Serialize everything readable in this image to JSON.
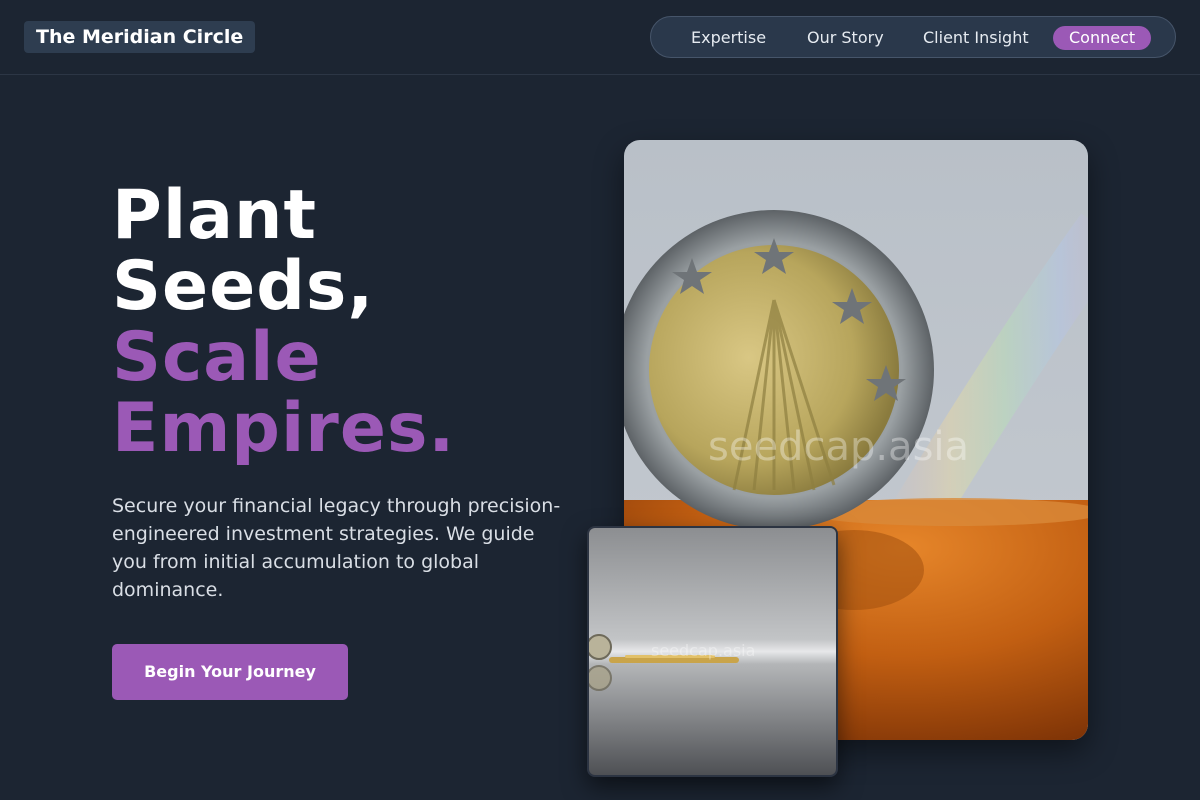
{
  "brand": {
    "name": "The Meridian Circle"
  },
  "nav": {
    "items": [
      {
        "label": "Expertise"
      },
      {
        "label": "Our Story"
      },
      {
        "label": "Client Insight"
      }
    ],
    "cta_label": "Connect"
  },
  "hero": {
    "headline_white": [
      "Plant",
      "Seeds,"
    ],
    "headline_accent": [
      "Scale",
      "Empires."
    ],
    "subtext": "Secure your financial legacy through precision-engineered investment strategies. We guide you from initial accumulation to global dominance.",
    "button_label": "Begin Your Journey"
  },
  "images": {
    "main_watermark": "seedcap.asia",
    "secondary_watermark": "seedcap.asia"
  },
  "colors": {
    "background": "#1c2532",
    "accent": "#9b59b6",
    "nav_background": "#2a384b"
  }
}
